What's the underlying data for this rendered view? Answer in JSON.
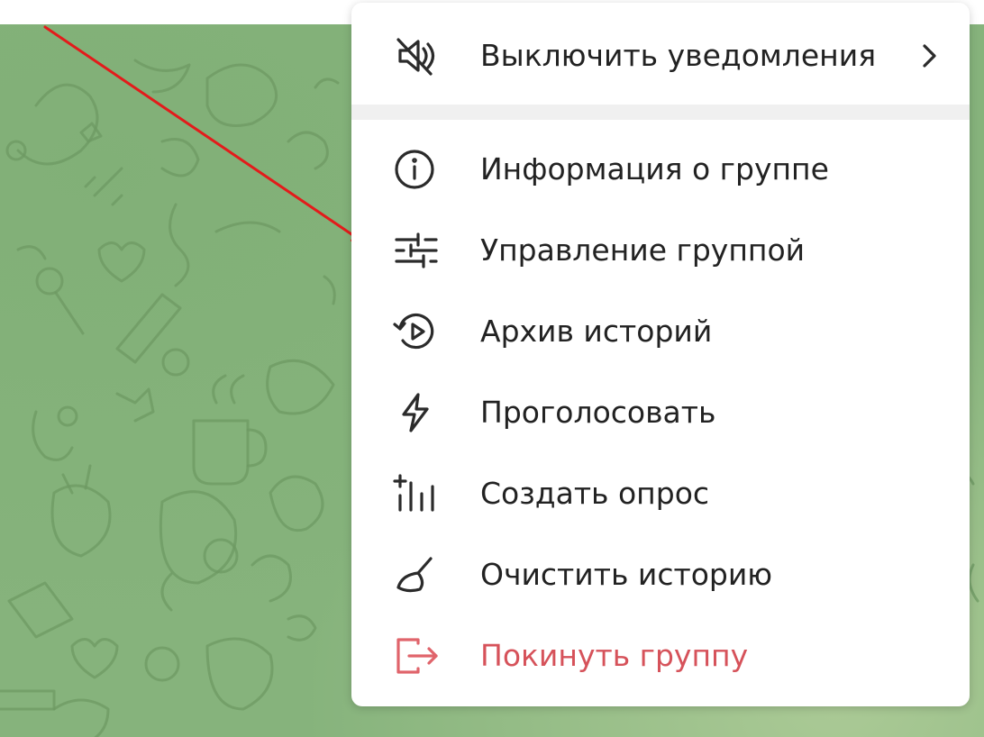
{
  "menu": {
    "mute": {
      "label": "Выключить уведомления",
      "icon": "mute-speaker-icon"
    },
    "items": [
      {
        "label": "Информация о группе",
        "icon": "info-icon"
      },
      {
        "label": "Управление группой",
        "icon": "sliders-icon"
      },
      {
        "label": "Архив историй",
        "icon": "stories-archive-icon"
      },
      {
        "label": "Проголосовать",
        "icon": "lightning-icon"
      },
      {
        "label": "Создать опрос",
        "icon": "poll-icon"
      },
      {
        "label": "Очистить историю",
        "icon": "broom-icon"
      },
      {
        "label": "Покинуть группу",
        "icon": "leave-icon"
      }
    ]
  },
  "colors": {
    "chat_background": "#86b37c",
    "danger": "#d6525a",
    "annotation_arrow": "#e31b1b"
  }
}
